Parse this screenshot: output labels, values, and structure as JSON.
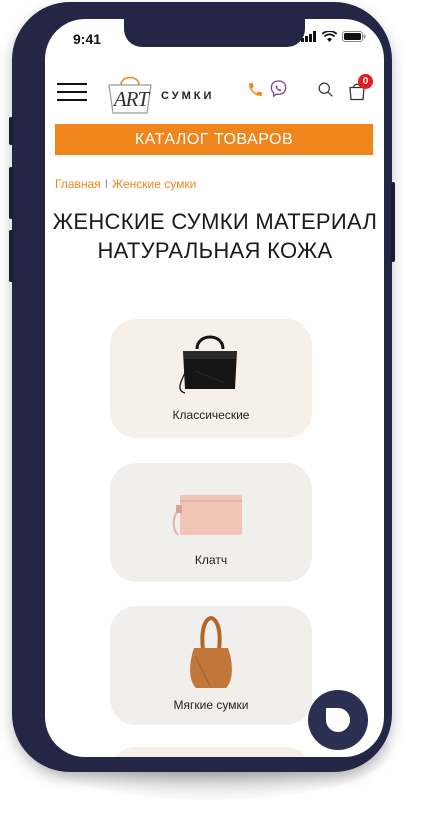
{
  "status_bar": {
    "time": "9:41"
  },
  "header": {
    "logo_art": "ART",
    "logo_sumki": "СУМКИ",
    "cart_count": "0"
  },
  "catalog_button": "КАТАЛОГ ТОВАРОВ",
  "breadcrumb": {
    "home": "Главная",
    "separator": "I",
    "current": "Женские сумки"
  },
  "page_title": "ЖЕНСКИЕ СУМКИ МАТЕРИАЛ НАТУРАЛЬНАЯ КОЖА",
  "categories": [
    {
      "label": "Классические",
      "icon": "classic-handbag-image",
      "bg": "#f6f0e8"
    },
    {
      "label": "Клатч",
      "icon": "clutch-image",
      "bg": "#f0efec"
    },
    {
      "label": "Мягкие сумки",
      "icon": "hobo-bag-image",
      "bg": "#f0efec"
    }
  ],
  "colors": {
    "accent": "#f0861b",
    "badge": "#e31b23",
    "viber": "#7f4da0",
    "phone_frame": "#232745"
  }
}
